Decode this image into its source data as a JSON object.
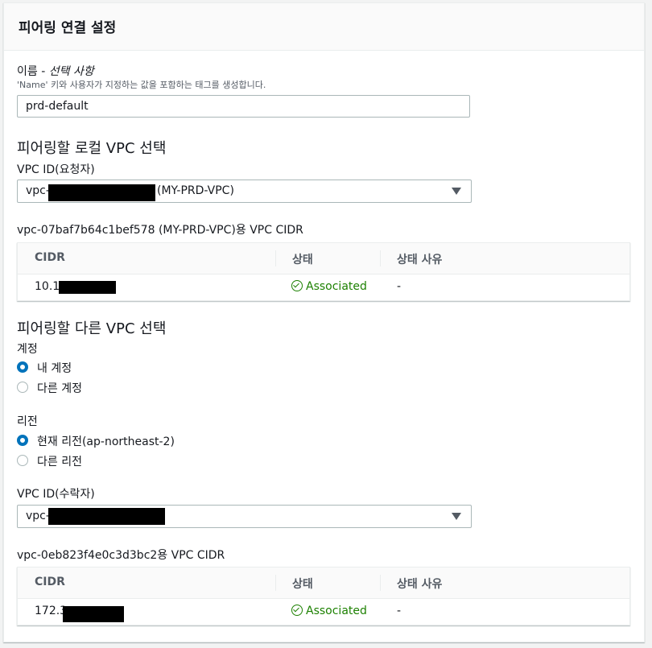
{
  "panel": {
    "title": "피어링 연결 설정"
  },
  "name_field": {
    "label": "이름",
    "optional": "선택 사항",
    "description": "'Name' 키와 사용자가 지정하는 값을 포함하는 태그를 생성합니다.",
    "value": "prd-default"
  },
  "local_vpc": {
    "heading": "피어링할 로컬 VPC 선택",
    "vpc_id_label": "VPC ID(요청자)",
    "select_prefix": "vpc-0",
    "select_suffix": "(MY-PRD-VPC)",
    "cidr_table_title": "vpc-07baf7b64c1bef578 (MY-PRD-VPC)용 VPC CIDR",
    "table": {
      "headers": [
        "CIDR",
        "상태",
        "상태 사유"
      ],
      "rows": [
        {
          "cidr_prefix": "10.1",
          "status": "Associated",
          "reason": "-"
        }
      ]
    }
  },
  "peer_vpc": {
    "heading": "피어링할 다른 VPC 선택",
    "account": {
      "label": "계정",
      "options": [
        "내 계정",
        "다른 계정"
      ],
      "selected": "내 계정"
    },
    "region": {
      "label": "리전",
      "options": [
        "현재 리전(ap-northeast-2)",
        "다른 리전"
      ],
      "selected": "현재 리전(ap-northeast-2)"
    },
    "vpc_id_label": "VPC ID(수락자)",
    "select_prefix": "vpc-",
    "cidr_table_title": "vpc-0eb823f4e0c3d3bc2용 VPC CIDR",
    "table": {
      "headers": [
        "CIDR",
        "상태",
        "상태 사유"
      ],
      "rows": [
        {
          "cidr_prefix": "172.3",
          "status": "Associated",
          "reason": "-"
        }
      ]
    }
  },
  "colors": {
    "accent": "#0073bb",
    "success": "#1d8102",
    "redaction": "#000000"
  },
  "icons": {
    "select_caret": "caret-down-icon",
    "status": "status-check-circle-icon"
  }
}
